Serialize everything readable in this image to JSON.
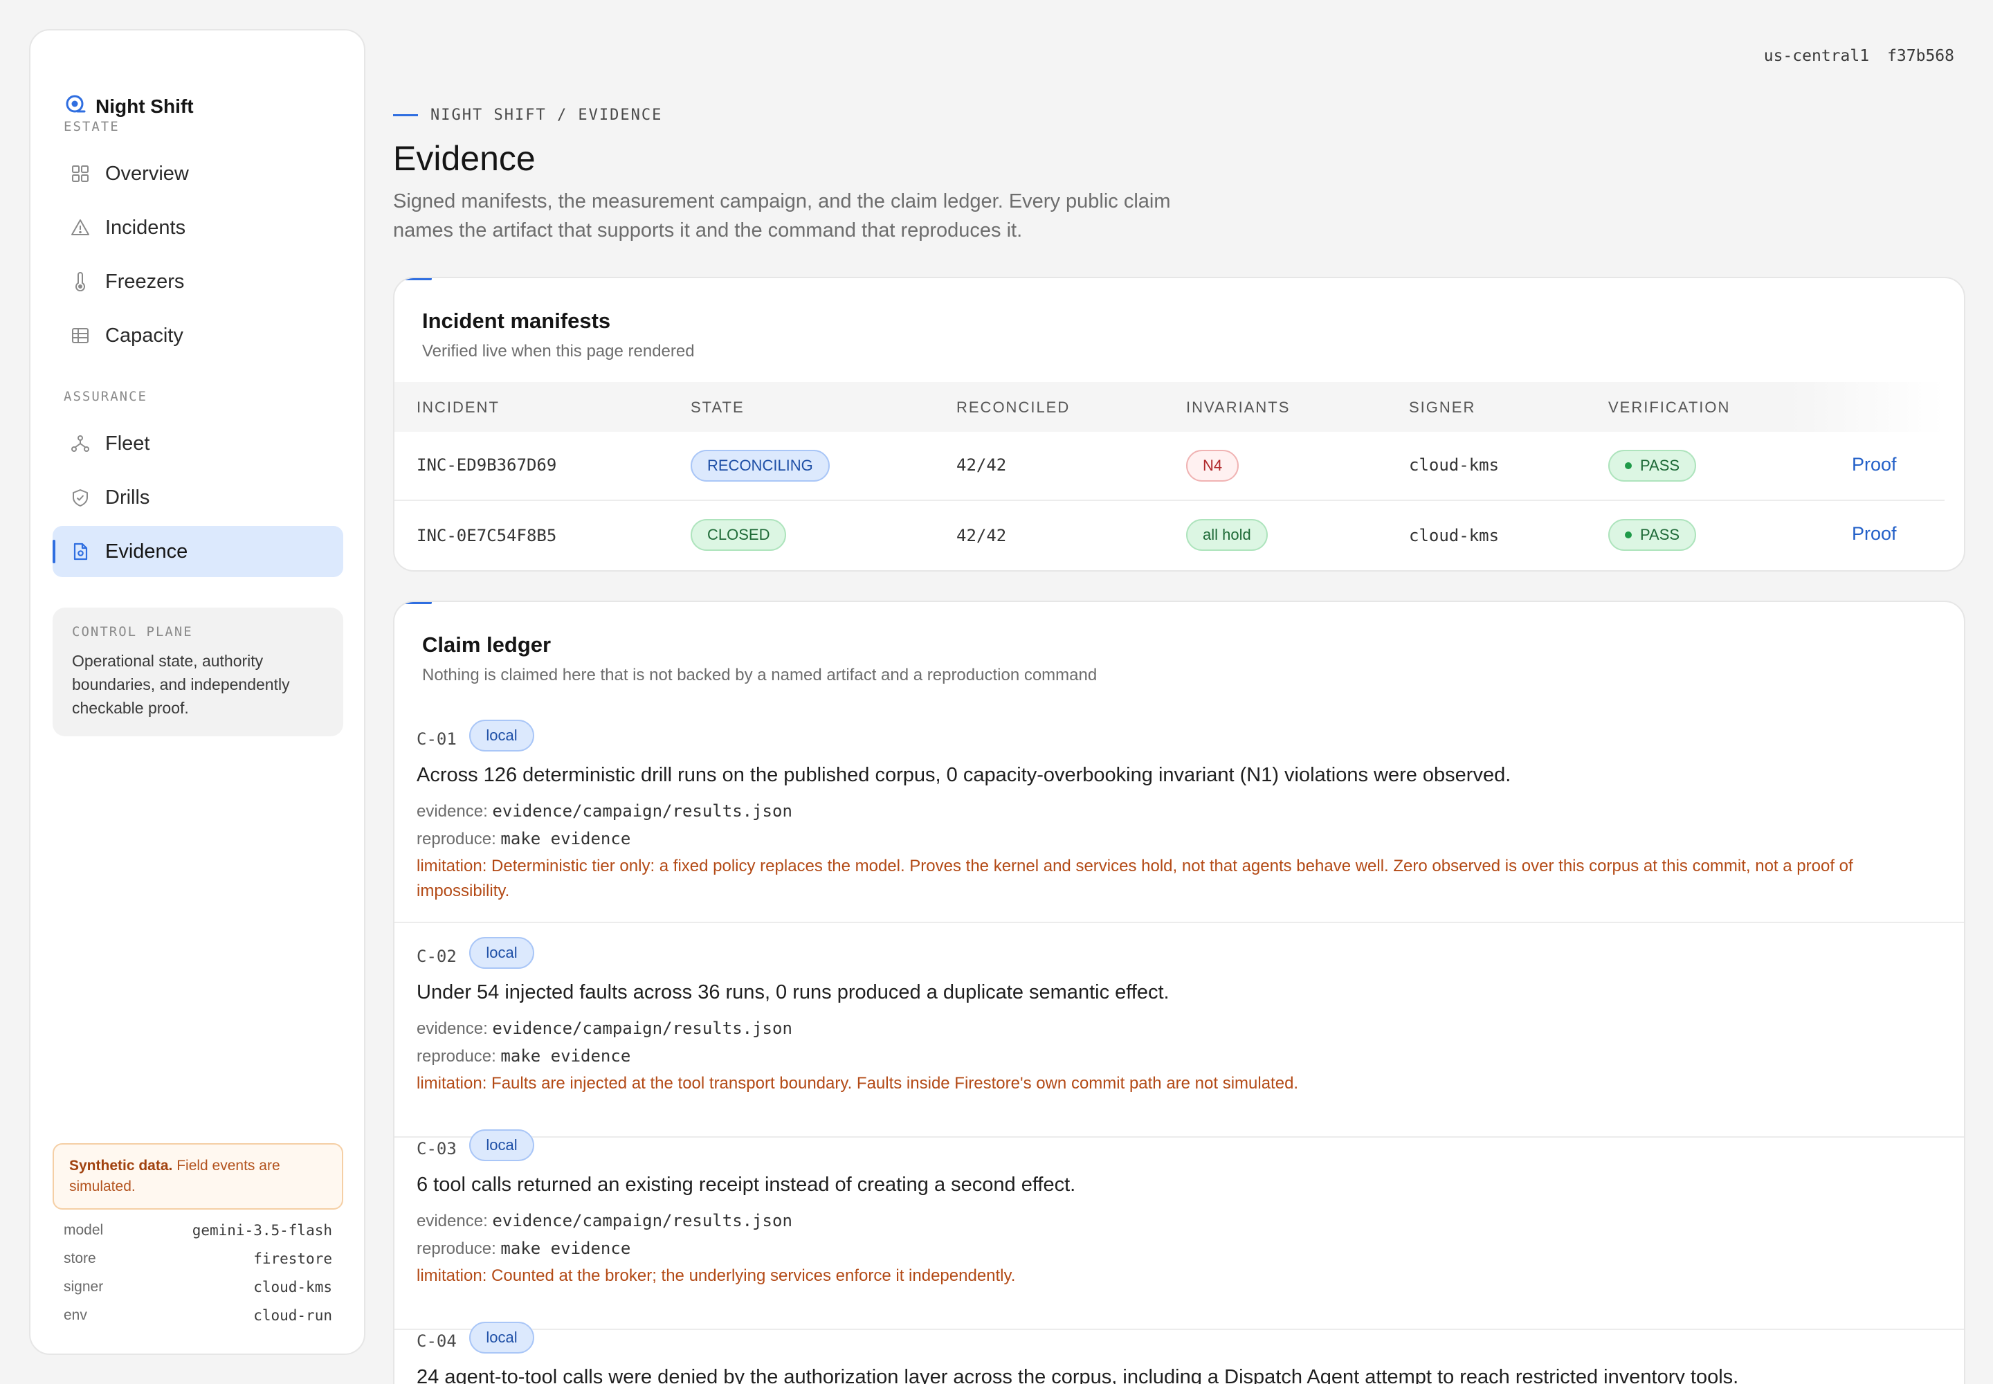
{
  "brand": {
    "name": "Night Shift",
    "accent": "#2f6ee0"
  },
  "sidebar": {
    "sections": [
      {
        "label": "ESTATE",
        "items": [
          {
            "label": "Overview",
            "icon": "grid-icon"
          },
          {
            "label": "Incidents",
            "icon": "warning-triangle-icon"
          },
          {
            "label": "Freezers",
            "icon": "thermometer-icon"
          },
          {
            "label": "Capacity",
            "icon": "table-icon"
          }
        ]
      },
      {
        "label": "ASSURANCE",
        "items": [
          {
            "label": "Fleet",
            "icon": "network-icon"
          },
          {
            "label": "Drills",
            "icon": "shield-check-icon"
          },
          {
            "label": "Evidence",
            "icon": "document-icon",
            "active": true
          }
        ]
      }
    ],
    "control_plane": {
      "title": "CONTROL PLANE",
      "text": "Operational state, authority boundaries, and independently checkable proof."
    },
    "synthetic": {
      "strong": "Synthetic data.",
      "text": " Field events are simulated."
    },
    "meta": [
      {
        "key": "model",
        "value": "gemini-3.5-flash"
      },
      {
        "key": "store",
        "value": "firestore"
      },
      {
        "key": "signer",
        "value": "cloud-kms"
      },
      {
        "key": "env",
        "value": "cloud-run"
      }
    ]
  },
  "topbar": {
    "region": "us-central1",
    "commit": "f37b568"
  },
  "header": {
    "breadcrumb": "NIGHT SHIFT / EVIDENCE",
    "title": "Evidence",
    "description": "Signed manifests, the measurement campaign, and the claim ledger. Every public claim names the artifact that supports it and the command that reproduces it."
  },
  "manifests": {
    "title": "Incident manifests",
    "subtitle": "Verified live when this page rendered",
    "columns": [
      "INCIDENT",
      "STATE",
      "RECONCILED",
      "INVARIANTS",
      "SIGNER",
      "VERIFICATION"
    ],
    "rows": [
      {
        "incident": "INC-ED9B367D69",
        "state": "RECONCILING",
        "reconciled": "42/42",
        "invariants": "N4",
        "signer": "cloud-kms",
        "verification": "PASS",
        "action": "Proof"
      },
      {
        "incident": "INC-0E7C54F8B5",
        "state": "CLOSED",
        "reconciled": "42/42",
        "invariants": "all hold",
        "signer": "cloud-kms",
        "verification": "PASS",
        "action": "Proof"
      }
    ]
  },
  "ledger": {
    "title": "Claim ledger",
    "subtitle": "Nothing is claimed here that is not backed by a named artifact and a reproduction command",
    "evidence_prefix": "evidence:",
    "reproduce_prefix": "reproduce:",
    "limitation_prefix": "limitation:",
    "claims": [
      {
        "id": "C-01",
        "scope": "local",
        "text": "Across 126 deterministic drill runs on the published corpus, 0 capacity-overbooking invariant (N1) violations were observed.",
        "evidence": "evidence/campaign/results.json",
        "reproduce": "make evidence",
        "limitation": "Deterministic tier only: a fixed policy replaces the model. Proves the kernel and services hold, not that agents behave well. Zero observed is over this corpus at this commit, not a proof of impossibility."
      },
      {
        "id": "C-02",
        "scope": "local",
        "text": "Under 54 injected faults across 36 runs, 0 runs produced a duplicate semantic effect.",
        "evidence": "evidence/campaign/results.json",
        "reproduce": "make evidence",
        "limitation": "Faults are injected at the tool transport boundary. Faults inside Firestore's own commit path are not simulated."
      },
      {
        "id": "C-03",
        "scope": "local",
        "text": "6 tool calls returned an existing receipt instead of creating a second effect.",
        "evidence": "evidence/campaign/results.json",
        "reproduce": "make evidence",
        "limitation": "Counted at the broker; the underlying services enforce it independently."
      },
      {
        "id": "C-04",
        "scope": "local",
        "text": "24 agent-to-tool calls were denied by the authorization layer across the corpus, including a Dispatch Agent attempt to reach restricted inventory tools."
      }
    ]
  }
}
